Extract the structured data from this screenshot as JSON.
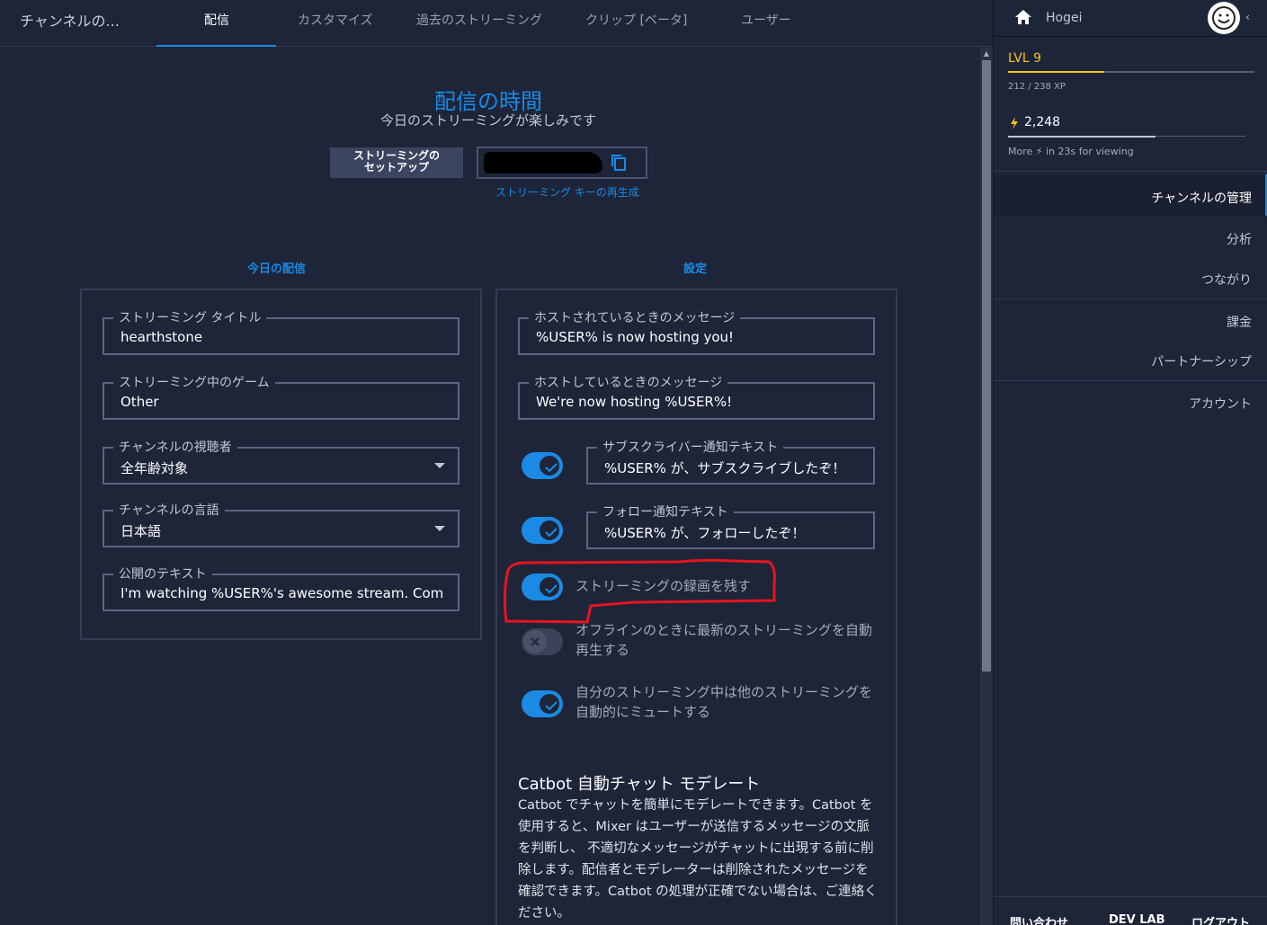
{
  "nav": {
    "brand": "チャンネルの...",
    "tabs": [
      "配信",
      "カスタマイズ",
      "過去のストリーミング",
      "クリップ [ベータ]",
      "ユーザー"
    ]
  },
  "hero": {
    "title": "配信の時間",
    "subtitle": "今日のストリーミングが楽しみです"
  },
  "setup": {
    "button_label": "ストリーミングの\nセットアップ",
    "regen_link": "ストリーミング キーの再生成"
  },
  "today": {
    "heading": "今日の配信",
    "fields": [
      {
        "label": "ストリーミング タイトル",
        "value": "hearthstone"
      },
      {
        "label": "ストリーミング中のゲーム",
        "value": "Other"
      },
      {
        "label": "チャンネルの視聴者",
        "value": "全年齢対象"
      },
      {
        "label": "チャンネルの言語",
        "value": "日本語"
      },
      {
        "label": "公開のテキスト",
        "value": "I'm watching %USER%'s awesome stream. Come c"
      }
    ]
  },
  "settings": {
    "heading": "設定",
    "host_messages": [
      {
        "label": "ホストされているときのメッセージ",
        "value": "%USER% is now hosting you!"
      },
      {
        "label": "ホストしているときのメッセージ",
        "value": "We're now hosting %USER%!"
      }
    ],
    "notify_fields": [
      {
        "label": "サブスクライバー通知テキスト",
        "value": "%USER% が、サブスクライブしたぞ！",
        "enabled": true
      },
      {
        "label": "フォロー通知テキスト",
        "value": "%USER% が、フォローしたぞ！",
        "enabled": true
      }
    ],
    "toggles": [
      {
        "label": "ストリーミングの録画を残す",
        "enabled": true
      },
      {
        "label": "オフラインのときに最新のストリーミングを自動再生する",
        "enabled": false
      },
      {
        "label": "自分のストリーミング中は他のストリーミングを自動的にミュートする",
        "enabled": true
      }
    ]
  },
  "catbot": {
    "title": "Catbot 自動チャット モデレート",
    "body": "Catbot でチャットを簡単にモデレートできます。Catbot を使用すると、Mixer はユーザーが送信するメッセージの文脈を判断し、 不適切なメッセージがチャットに出現する前に削除します。配信者とモデレーターは削除されたメッセージを 確認できます。Catbot の処理が正確でない場合は、ご連絡ください。"
  },
  "sidebar": {
    "username": "Hogei",
    "level": "LVL 9",
    "xp_text": "212 / 238 XP",
    "xp_progress": 0.39,
    "sparks": "2,248",
    "sparks_progress": 0.62,
    "more_text": "More ⚡ in 23s for viewing",
    "menu": [
      {
        "label": "チャンネルの管理",
        "active": true
      },
      {
        "label": "分析",
        "active": false
      },
      {
        "label": "つながり",
        "active": false
      },
      {
        "label": "課金",
        "active": false
      },
      {
        "label": "パートナーシップ",
        "active": false
      },
      {
        "label": "アカウント",
        "active": false
      }
    ],
    "bottom_links": [
      "問い合わせ",
      "DEV LAB",
      "ログアウト"
    ]
  },
  "colors": {
    "accent": "#1a8ae5",
    "level": "#f5c518",
    "highlight": "#e8141e"
  }
}
